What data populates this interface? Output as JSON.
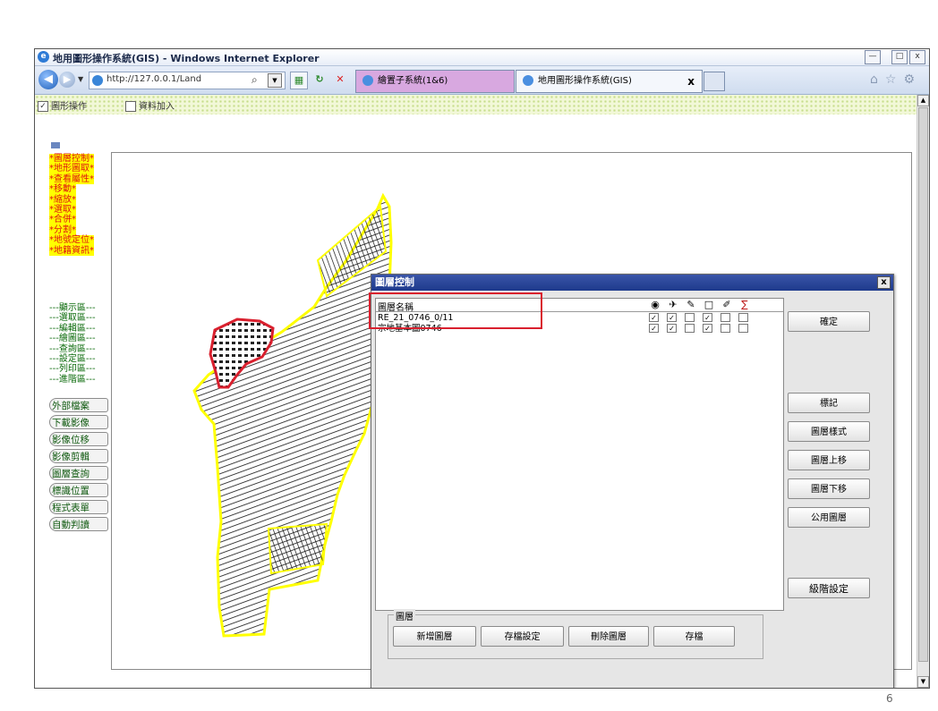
{
  "window": {
    "title": "地用圖形操作系統(GIS) - Windows Internet Explorer",
    "controls": [
      "—",
      "□",
      "x"
    ]
  },
  "navbar": {
    "url": "http://127.0.0.1/Land ",
    "tabs": [
      {
        "label": "繪置子系統(1&6)"
      },
      {
        "label": "地用圖形操作系統(GIS)",
        "close": "x"
      }
    ]
  },
  "checkbar": {
    "items": [
      {
        "label": "圖形操作",
        "checked": true
      },
      {
        "label": "資料加入",
        "checked": false
      }
    ]
  },
  "sidebar": {
    "menu_yellow": [
      "*圖層控制*",
      "*地形圖取*",
      "*查看屬性*",
      "*移動*",
      "*縮放*",
      "*選取*",
      "*合併*",
      "*分割*",
      "*地號定位*",
      "*地籍資訊*"
    ],
    "menu_green": [
      "---顯示區---",
      "---選取區---",
      "---編輯區---",
      "---繪圖區---",
      "---查詢區---",
      "---設定區---",
      "---列印區---",
      "---進階區---"
    ],
    "buttons": [
      "外部檔案",
      "下載影像",
      "影像位移",
      "影像剪輯",
      "圖層查詢",
      "標識位置",
      "程式表單",
      "自動判讀"
    ]
  },
  "dialog": {
    "title": "圖層控制",
    "close": "x",
    "table": {
      "header": "圖層名稱",
      "column_icons": [
        "eye-icon",
        "cursor-icon",
        "pen-icon",
        "square-icon",
        "pencil-icon",
        "sigma-icon"
      ],
      "column_glyphs": [
        "◉",
        "✈",
        "✎",
        "□",
        "✐",
        "∑"
      ],
      "rows": [
        {
          "name": "RE_21_0746_0/11",
          "checks": [
            true,
            true,
            false,
            true,
            false,
            false
          ]
        },
        {
          "name": "宗地基本圖0746",
          "checks": [
            true,
            true,
            false,
            true,
            false,
            false
          ]
        }
      ]
    },
    "buttons": {
      "confirm": "確定",
      "mark": "標記",
      "layer_style": "圖層樣式",
      "move_up": "圖層上移",
      "move_down": "圖層下移",
      "public_layers": "公用圖層",
      "step_setting": "級階設定"
    },
    "group": {
      "legend": "圖層",
      "buttons": [
        "新增圖層",
        "存檔設定",
        "刪除圖層",
        "存檔"
      ]
    }
  },
  "page_number": "6",
  "colors": {
    "menu_red": "#e01010",
    "menu_yellow": "#ffff00",
    "menu_green": "#0a6a0a",
    "highlight_red": "#d9202e",
    "dialog_title": "#1e3a8c",
    "parcel_outline": "#ffff00"
  }
}
